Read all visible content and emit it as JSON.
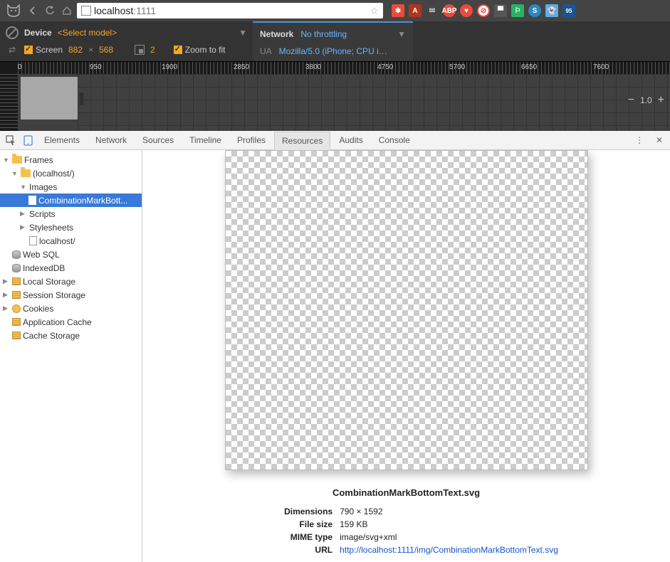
{
  "browser": {
    "url_host": "localhost",
    "url_port": ":1111"
  },
  "deviceBar": {
    "device_label": "Device",
    "device_select": "<Select model>",
    "screen_label": "Screen",
    "width": "882",
    "x": "×",
    "height": "568",
    "dpr": "2",
    "zoom_fit": "Zoom to fit",
    "network_label": "Network",
    "throttling": "No throttling",
    "ua_label": "UA",
    "ua_value": "Mozilla/5.0 (iPhone; CPU iPhon..."
  },
  "ruler": {
    "ticks": [
      "0",
      "950",
      "1900",
      "2850",
      "3800",
      "4750",
      "5700",
      "6650",
      "7600"
    ]
  },
  "zoom": {
    "minus": "−",
    "value": "1.0",
    "plus": "+"
  },
  "tabs": {
    "elements": "Elements",
    "network": "Network",
    "sources": "Sources",
    "timeline": "Timeline",
    "profiles": "Profiles",
    "resources": "Resources",
    "audits": "Audits",
    "console": "Console"
  },
  "tree": {
    "frames": "Frames",
    "localhost": "(localhost/)",
    "images": "Images",
    "selected_file": "CombinationMarkBott...",
    "scripts": "Scripts",
    "stylesheets": "Stylesheets",
    "localhost_file": "localhost/",
    "websql": "Web SQL",
    "indexeddb": "IndexedDB",
    "localstorage": "Local Storage",
    "sessionstorage": "Session Storage",
    "cookies": "Cookies",
    "appcache": "Application Cache",
    "cachestorage": "Cache Storage"
  },
  "preview": {
    "filename": "CombinationMarkBottomText.svg",
    "dim_label": "Dimensions",
    "dim_value": "790 × 1592",
    "size_label": "File size",
    "size_value": "159 KB",
    "mime_label": "MIME type",
    "mime_value": "image/svg+xml",
    "url_label": "URL",
    "url_value": "http://localhost:1111/img/CombinationMarkBottomText.svg"
  }
}
